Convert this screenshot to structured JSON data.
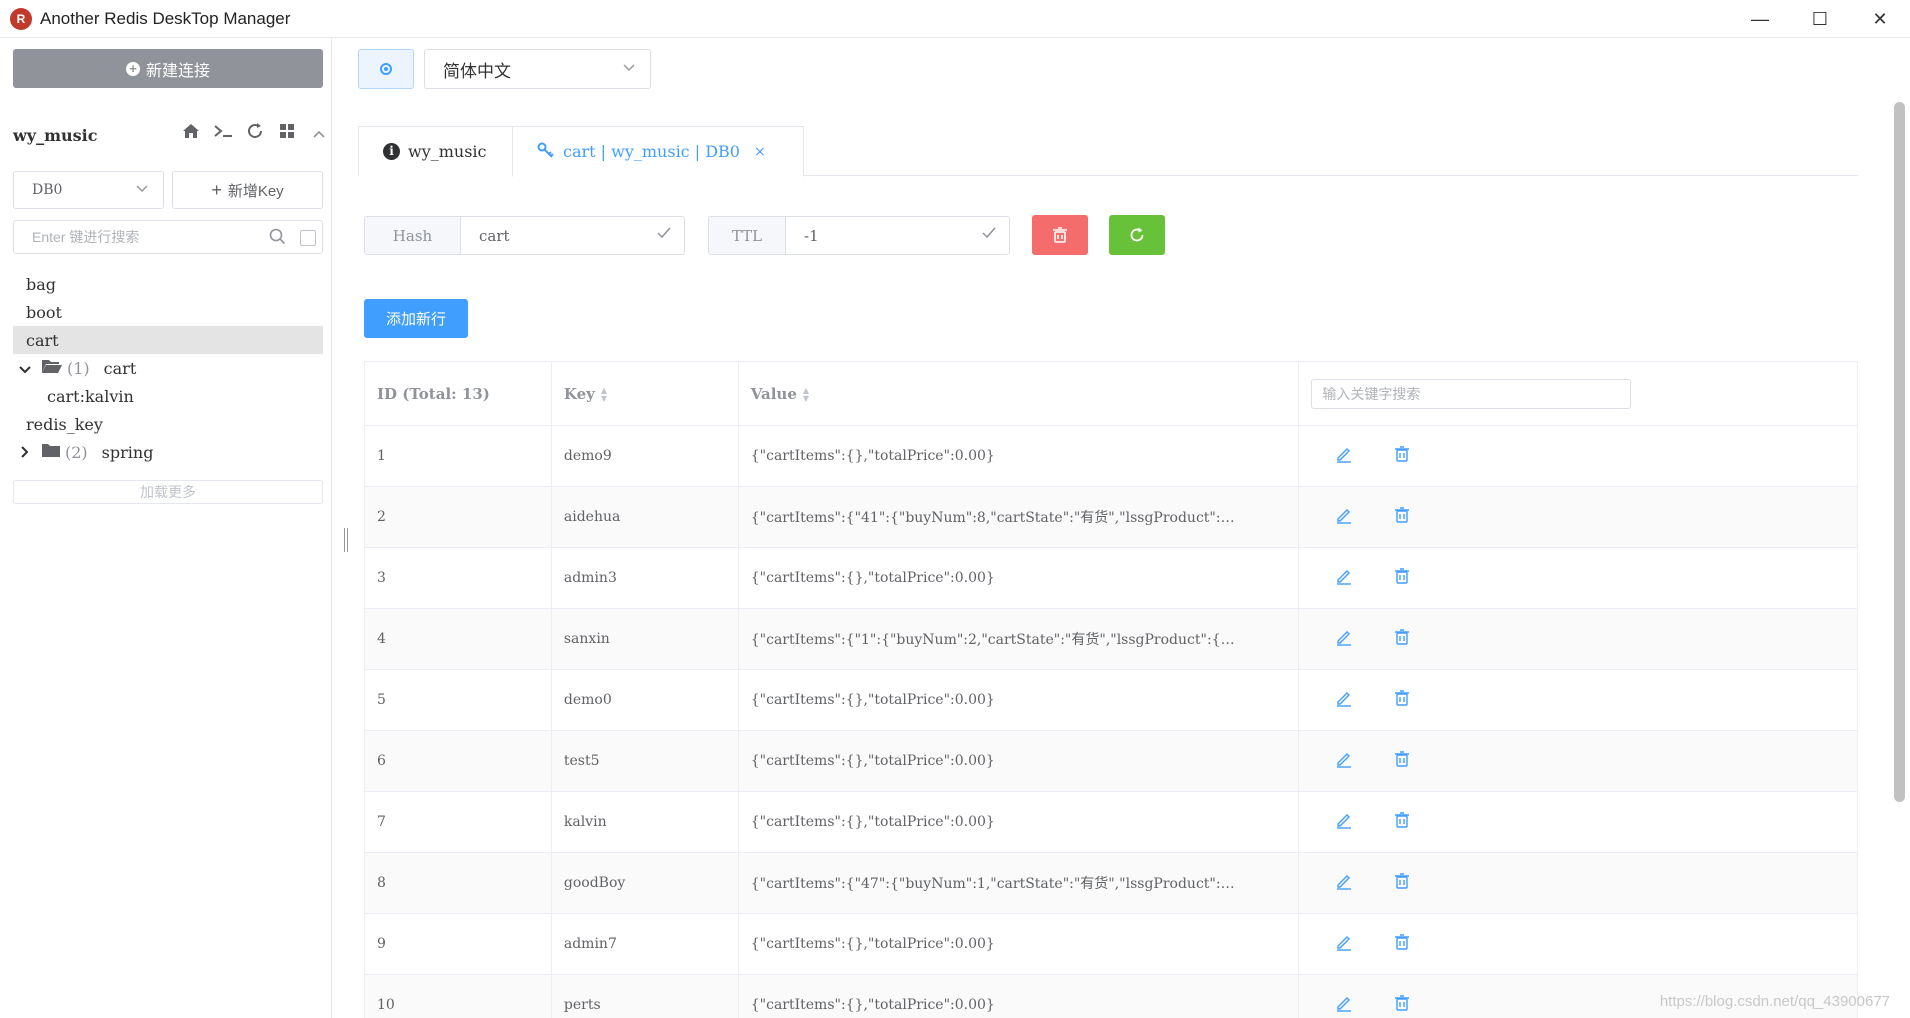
{
  "window": {
    "title": "Another Redis DeskTop Manager",
    "icon_letter": "R",
    "minimize": "—",
    "maximize": "☐",
    "close": "✕"
  },
  "sidebar": {
    "new_connection": "新建连接",
    "connection_name": "wy_music",
    "db_select": "DB0",
    "new_key": "新增Key",
    "search_placeholder": "Enter 键进行搜索",
    "tree": [
      {
        "label": "bag"
      },
      {
        "label": "boot"
      },
      {
        "label": "cart"
      },
      {
        "arrow": "⌄",
        "count": "(1)",
        "label": "cart"
      },
      {
        "label": "cart:kalvin"
      },
      {
        "label": "redis_key"
      },
      {
        "arrow": "›",
        "count": "(2)",
        "label": "spring"
      }
    ],
    "load_more": "加载更多"
  },
  "header": {
    "language": "简体中文"
  },
  "tabs": [
    {
      "label": "wy_music"
    },
    {
      "label": "cart | wy_music | DB0",
      "close": "×"
    }
  ],
  "key_detail": {
    "type": "Hash",
    "key_name": "cart",
    "ttl_label": "TTL",
    "ttl_value": "-1",
    "add_row": "添加新行"
  },
  "table": {
    "headers": {
      "id": "ID (Total: 13)",
      "key": "Key",
      "value": "Value",
      "search_placeholder": "输入关键字搜索"
    },
    "rows": [
      {
        "id": "1",
        "key": "demo9",
        "value": "{\"cartItems\":{},\"totalPrice\":0.00}"
      },
      {
        "id": "2",
        "key": "aidehua",
        "value": "{\"cartItems\":{\"41\":{\"buyNum\":8,\"cartState\":\"有货\",\"lssgProduct\":…"
      },
      {
        "id": "3",
        "key": "admin3",
        "value": "{\"cartItems\":{},\"totalPrice\":0.00}"
      },
      {
        "id": "4",
        "key": "sanxin",
        "value": "{\"cartItems\":{\"1\":{\"buyNum\":2,\"cartState\":\"有货\",\"lssgProduct\":{…"
      },
      {
        "id": "5",
        "key": "demo0",
        "value": "{\"cartItems\":{},\"totalPrice\":0.00}"
      },
      {
        "id": "6",
        "key": "test5",
        "value": "{\"cartItems\":{},\"totalPrice\":0.00}"
      },
      {
        "id": "7",
        "key": "kalvin",
        "value": "{\"cartItems\":{},\"totalPrice\":0.00}"
      },
      {
        "id": "8",
        "key": "goodBoy",
        "value": "{\"cartItems\":{\"47\":{\"buyNum\":1,\"cartState\":\"有货\",\"lssgProduct\":…"
      },
      {
        "id": "9",
        "key": "admin7",
        "value": "{\"cartItems\":{},\"totalPrice\":0.00}"
      },
      {
        "id": "10",
        "key": "perts",
        "value": "{\"cartItems\":{},\"totalPrice\":0.00}"
      }
    ]
  },
  "watermark": "https://blog.csdn.net/qq_43900677",
  "colors": {
    "primary": "#409eff",
    "danger": "#f56c6c",
    "success": "#67c23a",
    "neutral_button": "#909399"
  }
}
